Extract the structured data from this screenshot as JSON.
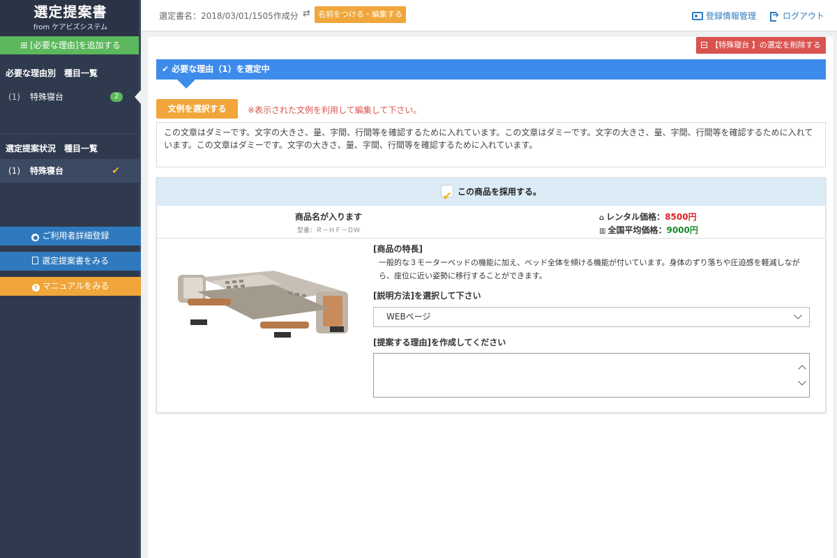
{
  "brand": {
    "title": "選定提案書",
    "subtitle": "from ケアビズシステム"
  },
  "sidebar": {
    "add_label": "⊞ [必要な理由]を追加する",
    "section1_title": "必要な理由別　種目一覧",
    "section1_items": [
      {
        "num": "(1)",
        "label": "特殊寝台",
        "badge": "2"
      }
    ],
    "section2_title": "選定提案状況　種目一覧",
    "section2_items": [
      {
        "num": "(1)",
        "label": "特殊寝台"
      }
    ],
    "btn_register": "ご利用者詳細登録",
    "btn_view_doc": "選定提案書をみる",
    "btn_manual": "マニュアルをみる"
  },
  "header": {
    "doc_name": "選定書名：2018/03/01/1505作成分",
    "swap_icon": "⇄",
    "rename_label": "名前をつける・編集する",
    "account_label": "登録情報管理",
    "logout_label": "ログアウト"
  },
  "main": {
    "delete_label": "【特殊寝台 】の選定を削除する",
    "reason_bar": "✔ 必要な理由（1）を選定中",
    "example_button": "文例を選択する",
    "example_note": "※表示された文例を利用して編集して下さい。",
    "reason_text": "この文章はダミーです。文字の大きさ、量、字間、行間等を確認するために入れています。この文章はダミーです。文字の大きさ、量、字間、行間等を確認するために入れています。この文章はダミーです。文字の大きさ、量、字間、行間等を確認するために入れています。",
    "product": {
      "adopt_label": "この商品を採用する。",
      "name": "商品名が入ります",
      "model": "型番：Ｒ－ＨＦ－ＤＷ",
      "rental_label": "レンタル価格：",
      "rental_price": "8500円",
      "avg_label": "全国平均価格：",
      "avg_price": "9000円",
      "features_title": "[商品の特長]",
      "features_text": "一般的な３モーターベッドの機能に加え、ベッド全体を傾ける機能が付いています。身体のずり落ちや圧迫感を軽減しながら、座位に近い姿勢に移行することができます。",
      "method_title": "[説明方法]を選択して下さい",
      "method_value": "WEBページ",
      "reason_title": "[提案する理由]を作成してください",
      "reason_value": ""
    }
  }
}
